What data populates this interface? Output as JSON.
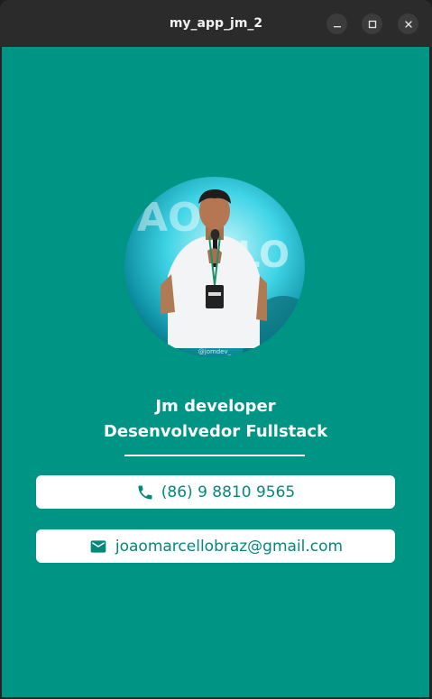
{
  "window": {
    "title": "my_app_jm_2"
  },
  "profile": {
    "name": "Jm developer",
    "role": "Desenvolvedor Fullstack"
  },
  "contacts": {
    "phone": {
      "icon": "phone-icon",
      "value": "(86) 9 8810 9565"
    },
    "email": {
      "icon": "email-icon",
      "value": "joaomarcellobraz@gmail.com"
    }
  },
  "colors": {
    "background": "#009485",
    "card": "#ffffff",
    "accent_text": "#00897b"
  }
}
